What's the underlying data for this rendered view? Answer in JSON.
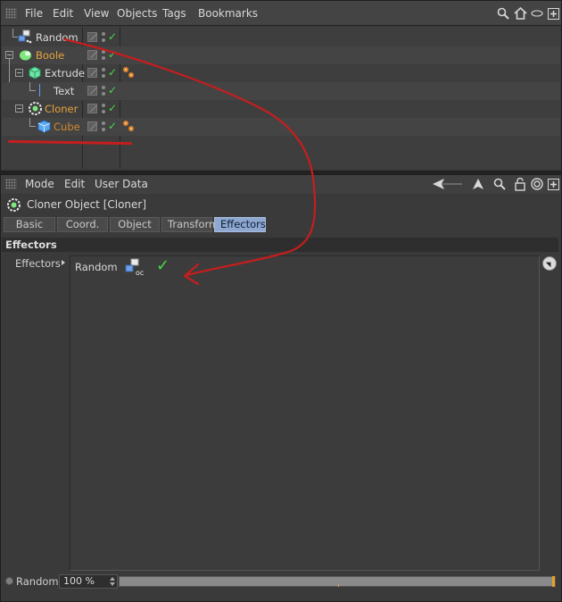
{
  "object_manager": {
    "menu": [
      "File",
      "Edit",
      "View",
      "Objects",
      "Tags",
      "Bookmarks"
    ],
    "tools": [
      "search-icon",
      "home-icon",
      "link-icon",
      "new-window-icon"
    ],
    "objects": [
      {
        "name": "Random",
        "color": "#dcdcdc",
        "icon": "random-effector-icon",
        "indent": 0,
        "has_tag": false
      },
      {
        "name": "Boole",
        "color": "#e8a43c",
        "icon": "boole-icon",
        "indent": 0,
        "has_tag": false
      },
      {
        "name": "Extrude",
        "color": "#dcdcdc",
        "icon": "extrude-icon",
        "indent": 1,
        "has_tag": true
      },
      {
        "name": "Text",
        "color": "#dcdcdc",
        "icon": "text-spline-icon",
        "indent": 2,
        "has_tag": false
      },
      {
        "name": "Cloner",
        "color": "#e8a43c",
        "icon": "cloner-icon",
        "indent": 0,
        "has_tag": false
      },
      {
        "name": "Cube",
        "color": "#d3872f",
        "icon": "cube-icon",
        "indent": 1,
        "has_tag": true
      }
    ]
  },
  "attribute_manager": {
    "menu": [
      "Mode",
      "Edit",
      "User Data"
    ],
    "tools": [
      "back-arrow-icon",
      "up-arrow-icon",
      "search-icon",
      "lock-icon",
      "target-icon",
      "new-window-icon"
    ],
    "object_title": "Cloner Object [Cloner]",
    "tabs": [
      "Basic",
      "Coord.",
      "Object",
      "Transform",
      "Effectors"
    ],
    "active_tab": "Effectors",
    "section": "Effectors",
    "effectors_label": "Effectors",
    "effectors_list": [
      {
        "name": "Random",
        "icon": "random-effector-icon",
        "enabled": true
      }
    ],
    "strength": {
      "label": "Random",
      "value": "100 %",
      "level": 1.0
    }
  },
  "colors": {
    "annotation": "#c51e1e",
    "active_tab": "#8fa8cf",
    "check": "#48d848",
    "accent_orange": "#e8a43c"
  }
}
